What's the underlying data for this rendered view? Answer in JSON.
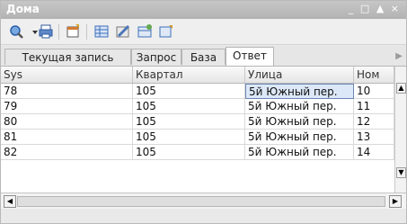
{
  "window": {
    "title": "Дома",
    "controls": [
      "_",
      "□",
      "▲",
      "×"
    ]
  },
  "toolbar": {
    "buttons": [
      "search-icon",
      "print-icon",
      "open-window-icon",
      "grid-icon",
      "edit-icon",
      "table-add-icon",
      "form-icon"
    ]
  },
  "tabs": [
    {
      "label": "Текущая запись",
      "active": false
    },
    {
      "label": "Запрос",
      "active": false
    },
    {
      "label": "База",
      "active": false
    },
    {
      "label": "Ответ",
      "active": true
    }
  ],
  "tab_scroll_arrow": "▶",
  "table": {
    "columns": [
      "Sys",
      "Квартал",
      "Улица",
      "Ном"
    ],
    "rows": [
      [
        "78",
        "105",
        "5й Южный пер.",
        "10"
      ],
      [
        "79",
        "105",
        "5й Южный пер.",
        "11"
      ],
      [
        "80",
        "105",
        "5й Южный пер.",
        "12"
      ],
      [
        "81",
        "105",
        "5й Южный пер.",
        "13"
      ],
      [
        "82",
        "105",
        "5й Южный пер.",
        "14"
      ]
    ]
  },
  "scrollbars": {
    "up": "▲",
    "down": "▼",
    "left": "◀",
    "right": "▶"
  },
  "colors": {
    "titlebar": "#b9b9b9",
    "selection": "#dce8f8",
    "focus_border": "#6d88b4"
  }
}
